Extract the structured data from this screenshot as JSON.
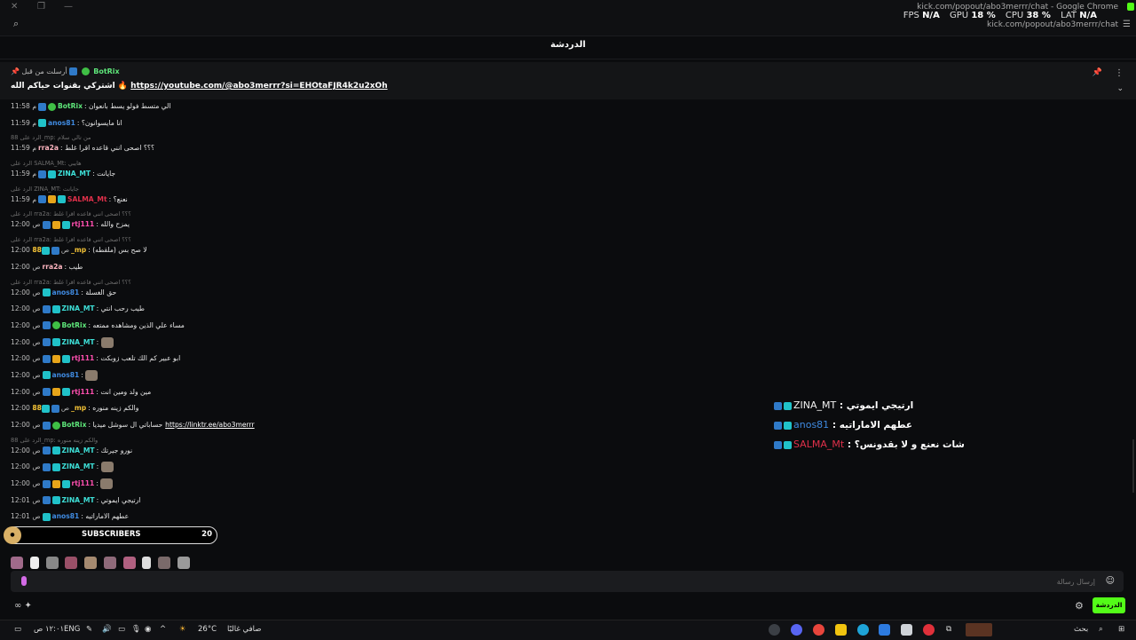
{
  "window": {
    "chrome_title": "kick.com/popout/abo3merrr/chat - Google Chrome",
    "url": "kick.com/popout/abo3merrr/chat"
  },
  "perf": {
    "fps_label": "FPS",
    "fps": "N/A",
    "gpu_label": "GPU",
    "gpu": "18 %",
    "cpu_label": "CPU",
    "cpu": "38 %",
    "lat_label": "LAT",
    "lat": "N/A"
  },
  "chat": {
    "header_title": "الدردشة",
    "pinned": {
      "sent_by": "أرسلت من قبل",
      "username": "BotRix",
      "message_prefix": "اشتركي بقنوات حياكم الله 🔥",
      "link": "https://youtube.com/@abo3merrr?si=EHOtaFJR4k2u2xOh"
    },
    "colors": {
      "ZINA_MT": "#3ee0d8",
      "anos81": "#3f8ae0",
      "rra2a": "#ffb6c1",
      "SALMA_Mt": "#e0304a",
      "rtj111": "#ff4fb0",
      "88_mp": "#f3c236",
      "BotRix": "#5ee67a"
    },
    "messages": [
      {
        "type": "msg",
        "time": "11:58 م",
        "badges": [
          "blue",
          "green"
        ],
        "user": "BotRix",
        "color": "#5ee67a",
        "text": "الي متسط فولو يسط بانعوان"
      },
      {
        "type": "msg",
        "time": "11:59 م",
        "badges": [
          "cyan"
        ],
        "user": "anos81",
        "color": "#3f8ae0",
        "text": "انا مايسوانون؟"
      },
      {
        "type": "reply",
        "text": "الرد على 88_mp: من تالي سلام"
      },
      {
        "type": "msg",
        "time": "11:59 م",
        "badges": [],
        "user": "rra2a",
        "color": "#ffb6c1",
        "text": "؟؟؟ اصحى انني قاعده اقرا غلط"
      },
      {
        "type": "reply",
        "text": "الرد على SALMA_Mt: هايبي"
      },
      {
        "type": "msg",
        "time": "11:59 م",
        "badges": [
          "blue",
          "cyan"
        ],
        "user": "ZINA_MT",
        "color": "#3ee0d8",
        "text": "جايانت"
      },
      {
        "type": "reply",
        "text": "الرد على ZINA_MT: جايانت"
      },
      {
        "type": "msg",
        "time": "11:59 م",
        "badges": [
          "blue",
          "gold",
          "cyan"
        ],
        "user": "SALMA_Mt",
        "color": "#e0304a",
        "text": "نعنع؟"
      },
      {
        "type": "reply",
        "text": "الرد على rra2a: ؟؟؟ اصحى انني قاعده اقرا غلط"
      },
      {
        "type": "msg",
        "time": "12:00 ص",
        "badges": [
          "blue",
          "gold",
          "cyan"
        ],
        "user": "rtj111",
        "color": "#ff4fb0",
        "text": "يمزح والله"
      },
      {
        "type": "reply",
        "text": "الرد على rra2a: ؟؟؟ اصحى انني قاعده اقرا غلط"
      },
      {
        "type": "msg",
        "time": "12:00 ص",
        "badges": [
          "blue",
          "cyan"
        ],
        "user": "88_mp",
        "color": "#f3c236",
        "text": "لا صح بس (ملقطه)"
      },
      {
        "type": "msg",
        "time": "12:00 ص",
        "badges": [],
        "user": "rra2a",
        "color": "#ffb6c1",
        "text": "طيب"
      },
      {
        "type": "reply",
        "text": "الرد على rra2a: ؟؟؟ اصحى انني قاعده اقرا غلط"
      },
      {
        "type": "msg",
        "time": "12:00 ص",
        "badges": [
          "cyan"
        ],
        "user": "anos81",
        "color": "#3f8ae0",
        "text": "حق الغسلة"
      },
      {
        "type": "msg",
        "time": "12:00 ص",
        "badges": [
          "blue",
          "cyan"
        ],
        "user": "ZINA_MT",
        "color": "#3ee0d8",
        "text": "طيب رحب انتي"
      },
      {
        "type": "msg",
        "time": "12:00 ص",
        "badges": [
          "blue",
          "green"
        ],
        "user": "BotRix",
        "color": "#5ee67a",
        "text": "مساء علي الذين ومشاهده ممتعه"
      },
      {
        "type": "msg",
        "time": "12:00 ص",
        "badges": [
          "blue",
          "cyan"
        ],
        "user": "ZINA_MT",
        "color": "#3ee0d8",
        "text": "",
        "emote": true
      },
      {
        "type": "msg",
        "time": "12:00 ص",
        "badges": [
          "blue",
          "gold",
          "cyan"
        ],
        "user": "rtj111",
        "color": "#ff4fb0",
        "text": "ابو عبير كم الك تلعب زوبكت"
      },
      {
        "type": "msg",
        "time": "12:00 ص",
        "badges": [
          "cyan"
        ],
        "user": "anos81",
        "color": "#3f8ae0",
        "text": "",
        "emote": true
      },
      {
        "type": "msg",
        "time": "12:00 ص",
        "badges": [
          "blue",
          "gold",
          "cyan"
        ],
        "user": "rtj111",
        "color": "#ff4fb0",
        "text": "مين ولد ومين انت"
      },
      {
        "type": "msg",
        "time": "12:00 ص",
        "badges": [
          "blue",
          "cyan"
        ],
        "user": "88_mp",
        "color": "#f3c236",
        "text": "والكم زينه منوره"
      },
      {
        "type": "msg",
        "time": "12:00 ص",
        "badges": [
          "blue",
          "green"
        ],
        "user": "BotRix",
        "color": "#5ee67a",
        "text": "حساباتي ال سوشل ميديا",
        "link": "https://linktr.ee/abo3merrr"
      },
      {
        "type": "reply",
        "text": "الرد على 88_mp: والكم زينه منوره"
      },
      {
        "type": "msg",
        "time": "12:00 ص",
        "badges": [
          "blue",
          "cyan"
        ],
        "user": "ZINA_MT",
        "color": "#3ee0d8",
        "text": "نورو جيرتك"
      },
      {
        "type": "msg",
        "time": "12:00 ص",
        "badges": [
          "blue",
          "cyan"
        ],
        "user": "ZINA_MT",
        "color": "#3ee0d8",
        "text": "",
        "emote": true
      },
      {
        "type": "msg",
        "time": "12:00 ص",
        "badges": [
          "blue",
          "gold",
          "cyan"
        ],
        "user": "rtj111",
        "color": "#ff4fb0",
        "text": "",
        "emote": true
      },
      {
        "type": "msg",
        "time": "12:01 ص",
        "badges": [
          "blue",
          "cyan"
        ],
        "user": "ZINA_MT",
        "color": "#3ee0d8",
        "text": "ارتيجي ايموتي"
      },
      {
        "type": "msg",
        "time": "12:01 ص",
        "badges": [
          "cyan"
        ],
        "user": "anos81",
        "color": "#3f8ae0",
        "text": "عطهم الاماراتيه"
      }
    ],
    "subscribers": {
      "label": "SUBSCRIBERS",
      "count": "20"
    },
    "input_placeholder": "إرسال رسالة",
    "send_label": "الدردشة"
  },
  "overlay": [
    {
      "user": "ZINA_MT",
      "color": "#f0f0f0",
      "text": "ارتيجي ايموتي"
    },
    {
      "user": "anos81",
      "color": "#3f8ae0",
      "text": "عطهم الاماراتيه"
    },
    {
      "user": "SALMA_Mt",
      "color": "#e0304a",
      "text": "شات نعنع و لا بقدونس؟"
    }
  ],
  "taskbar": {
    "time": "١٢:٠١ ص",
    "lang": "ENG",
    "weather_temp": "26°C",
    "weather_text": "صافي غالبًا",
    "search_label": "بحث"
  }
}
